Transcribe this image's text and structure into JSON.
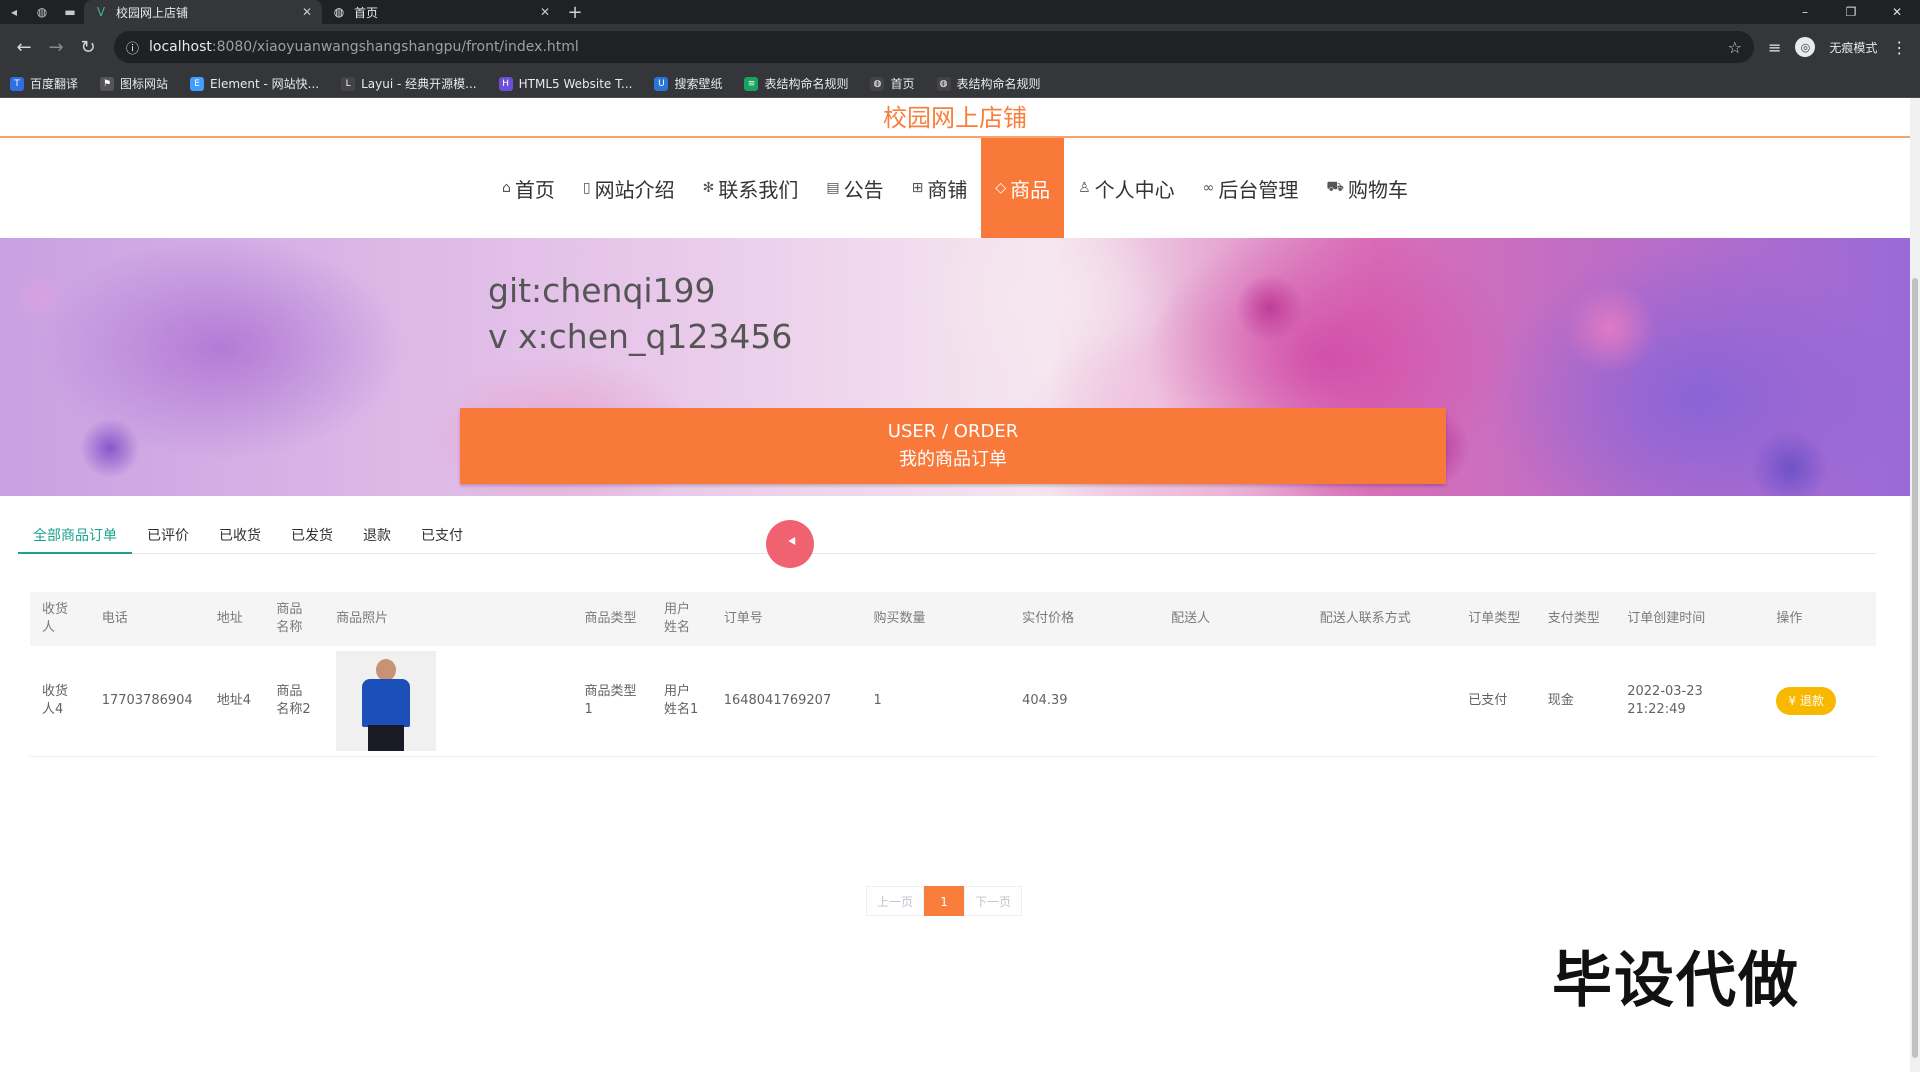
{
  "browser": {
    "tabs": [
      {
        "title": "校园网上店铺",
        "active": true
      },
      {
        "title": "首页",
        "active": false
      }
    ],
    "url_host": "localhost",
    "url_path": ":8080/xiaoyuanwangshangshangpu/front/index.html",
    "profile_label": "无痕模式",
    "bookmarks": [
      "百度翻译",
      "图标网站",
      "Element - 网站快...",
      "Layui - 经典开源模...",
      "HTML5 Website T...",
      "搜索壁纸",
      "表结构命名规则",
      "首页",
      "表结构命名规则"
    ]
  },
  "site": {
    "title": "校园网上店铺",
    "nav": [
      {
        "label": "首页",
        "icon": "home-icon"
      },
      {
        "label": "网站介绍",
        "icon": "doc-icon"
      },
      {
        "label": "联系我们",
        "icon": "snowflake-icon"
      },
      {
        "label": "公告",
        "icon": "notice-icon"
      },
      {
        "label": "商铺",
        "icon": "grid-icon"
      },
      {
        "label": "商品",
        "icon": "tag-icon",
        "active": true
      },
      {
        "label": "个人中心",
        "icon": "user-icon"
      },
      {
        "label": "后台管理",
        "icon": "link-icon"
      },
      {
        "label": "购物车",
        "icon": "cart-icon"
      }
    ]
  },
  "banner": {
    "line1": "git:chenqi199",
    "line2": "v x:chen_q123456",
    "slide_count": 3,
    "active_slide": 1
  },
  "order_header": {
    "title_en": "USER / ORDER",
    "title_cn": "我的商品订单"
  },
  "order_tabs": [
    {
      "label": "全部商品订单",
      "active": true
    },
    {
      "label": "已评价"
    },
    {
      "label": "已收货"
    },
    {
      "label": "已发货"
    },
    {
      "label": "退款"
    },
    {
      "label": "已支付"
    }
  ],
  "table": {
    "headers": [
      "收货人",
      "电话",
      "地址",
      "商品名称",
      "商品照片",
      "商品类型",
      "用户姓名",
      "订单号",
      "购买数量",
      "实付价格",
      "配送人",
      "配送人联系方式",
      "订单类型",
      "支付类型",
      "订单创建时间",
      "操作"
    ],
    "rows": [
      {
        "consignee": "收货人4",
        "phone": "17703786904",
        "address": "地址4",
        "product_name": "商品名称2",
        "product_type": "商品类型1",
        "user_name": "用户姓名1",
        "order_no": "1648041769207",
        "quantity": "1",
        "paid": "404.39",
        "courier": "",
        "courier_contact": "",
        "order_type": "已支付",
        "pay_type": "现金",
        "created": "2022-03-23 21:22:49",
        "action": "退款"
      }
    ]
  },
  "pager": {
    "prev": "上一页",
    "current": "1",
    "next": "下一页"
  },
  "watermark": "毕设代做",
  "colors": {
    "accent": "#f9793a",
    "tab_active": "#19a38e",
    "refund": "#f9b800"
  }
}
